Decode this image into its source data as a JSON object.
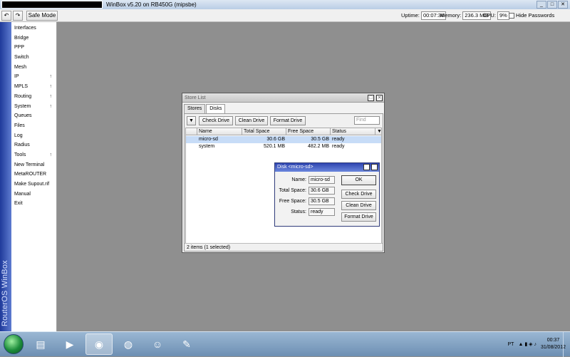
{
  "titlebar": {
    "title": "WinBox v5.20 on RB450G (mipsbe)",
    "controls": [
      "_",
      "□",
      "✕"
    ]
  },
  "toolbar": {
    "undo_icon": "↶",
    "redo_icon": "↷",
    "safe_mode_label": "Safe Mode",
    "uptime_label": "Uptime:",
    "uptime_value": "00:07:34",
    "memory_label": "Memory:",
    "memory_value": "236.3 MiB",
    "cpu_label": "CPU:",
    "cpu_value": "9%",
    "hide_passwords_label": "Hide Passwords"
  },
  "sidebar": {
    "brand": "RouterOS WinBox",
    "items": [
      {
        "label": "Interfaces",
        "submenu": false
      },
      {
        "label": "Bridge",
        "submenu": false
      },
      {
        "label": "PPP",
        "submenu": false
      },
      {
        "label": "Switch",
        "submenu": false
      },
      {
        "label": "Mesh",
        "submenu": false
      },
      {
        "label": "IP",
        "submenu": true
      },
      {
        "label": "MPLS",
        "submenu": true
      },
      {
        "label": "Routing",
        "submenu": true
      },
      {
        "label": "System",
        "submenu": true
      },
      {
        "label": "Queues",
        "submenu": false
      },
      {
        "label": "Files",
        "submenu": false
      },
      {
        "label": "Log",
        "submenu": false
      },
      {
        "label": "Radius",
        "submenu": false
      },
      {
        "label": "Tools",
        "submenu": true
      },
      {
        "label": "New Terminal",
        "submenu": false
      },
      {
        "label": "MetaROUTER",
        "submenu": false
      },
      {
        "label": "Make Supout.rif",
        "submenu": false
      },
      {
        "label": "Manual",
        "submenu": false
      },
      {
        "label": "Exit",
        "submenu": false
      }
    ],
    "submenu_arrow": "↑"
  },
  "store_list": {
    "title": "Store List",
    "tabs": [
      "Stores",
      "Disks"
    ],
    "filter_icon": "▼",
    "buttons": {
      "check_drive": "Check Drive",
      "clean_drive": "Clean Drive",
      "format_drive": "Format Drive"
    },
    "find_placeholder": "Find",
    "columns": [
      "Name",
      "Total Space",
      "Free Space",
      "Status"
    ],
    "rows": [
      {
        "name": "micro-sd",
        "total": "30.6 GB",
        "free": "30.5 GB",
        "status": "ready",
        "selected": true
      },
      {
        "name": "system",
        "total": "520.1 MB",
        "free": "482.2 MB",
        "status": "ready",
        "selected": false
      }
    ],
    "footer": "2 items (1 selected)"
  },
  "disk_dialog": {
    "title": "Disk <micro-sd>",
    "fields": [
      {
        "label": "Name:",
        "value": "micro-sd"
      },
      {
        "label": "Total Space:",
        "value": "30.6 GB"
      },
      {
        "label": "Free Space:",
        "value": "30.5 GB"
      },
      {
        "label": "Status:",
        "value": "ready"
      }
    ],
    "buttons": {
      "ok": "OK",
      "check_drive": "Check Drive",
      "clean_drive": "Clean Drive",
      "format_drive": "Format Drive"
    }
  },
  "taskbar": {
    "apps": [
      {
        "icon": "explorer-folder-icon",
        "glyph": "▤"
      },
      {
        "icon": "media-player-icon",
        "glyph": "▶"
      },
      {
        "icon": "teamspeak-icon",
        "glyph": "◉"
      },
      {
        "icon": "chrome-icon",
        "glyph": "◍"
      },
      {
        "icon": "users-icon",
        "glyph": "☺"
      },
      {
        "icon": "winbox-icon",
        "glyph": "✎"
      }
    ],
    "language": "PT",
    "time": "00:37",
    "date": "31/08/2012"
  }
}
